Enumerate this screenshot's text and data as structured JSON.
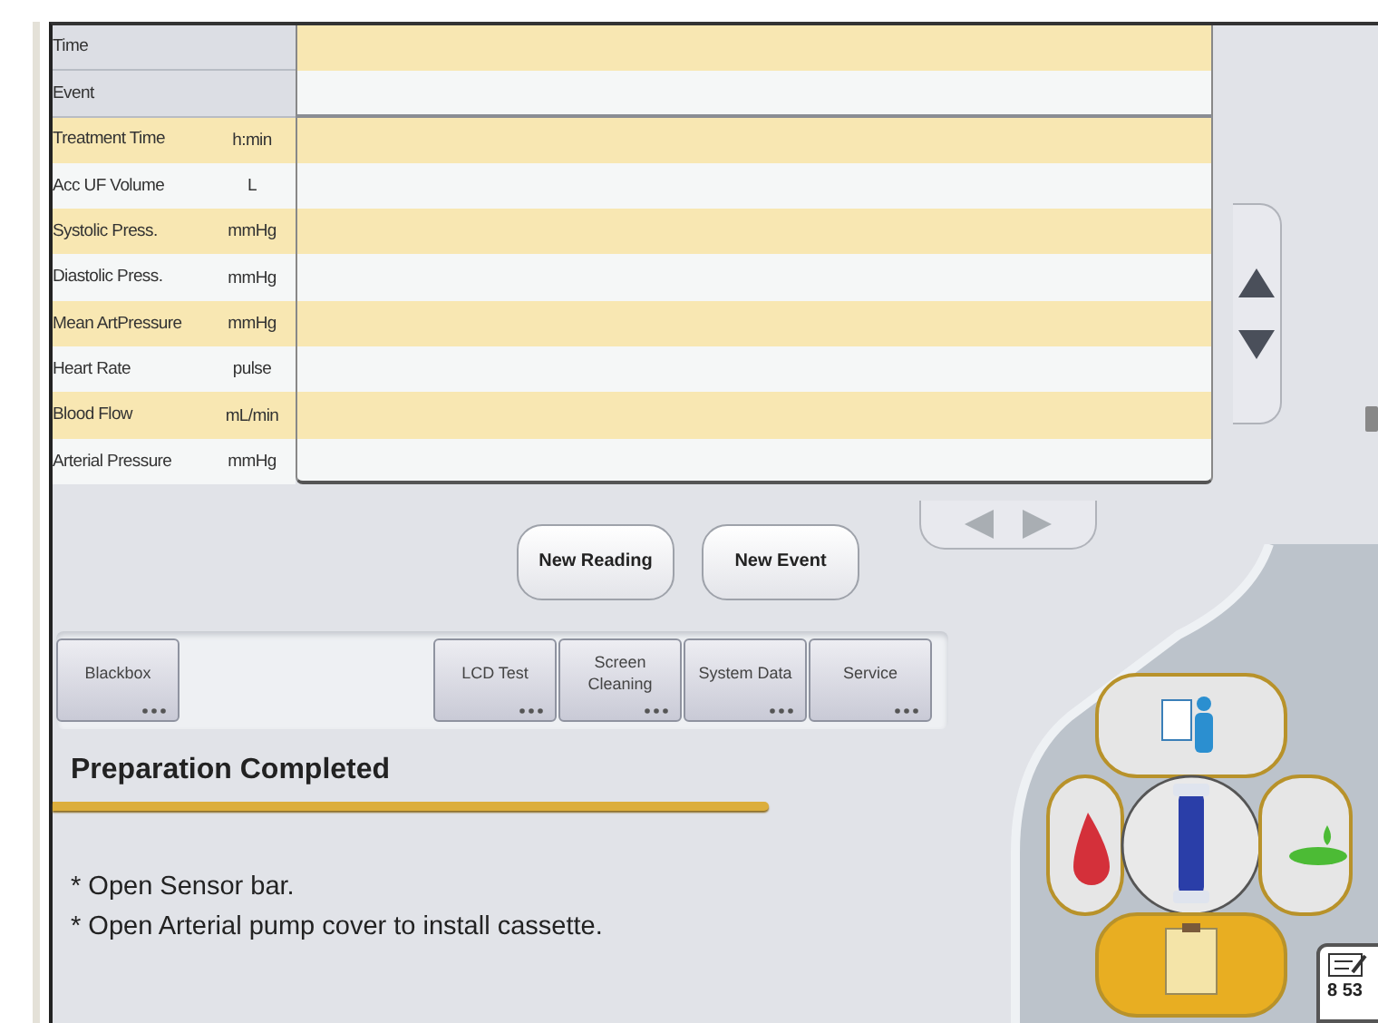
{
  "table": {
    "rows": [
      {
        "label": "Time",
        "kind": "header"
      },
      {
        "label": "Event",
        "kind": "header"
      },
      {
        "label": "Treatment Time",
        "unit": "h:min",
        "kind": "reading"
      },
      {
        "label": "Acc UF Volume",
        "unit": "L",
        "kind": "reading"
      },
      {
        "label": "Systolic Press.",
        "unit": "mmHg",
        "kind": "reading"
      },
      {
        "label": "Diastolic Press.",
        "unit": "mmHg",
        "kind": "reading"
      },
      {
        "label": "Mean ArtPressure",
        "unit": "mmHg",
        "kind": "reading"
      },
      {
        "label": "Heart Rate",
        "unit": "pulse",
        "kind": "reading"
      },
      {
        "label": "Blood Flow",
        "unit": "mL/min",
        "kind": "reading"
      },
      {
        "label": "Arterial Pressure",
        "unit": "mmHg",
        "kind": "reading"
      }
    ]
  },
  "actions": [
    "New Reading",
    "New Event"
  ],
  "toolbar": [
    {
      "label": "Blackbox",
      "kind": "left"
    },
    {
      "label": "LCD Test",
      "kind": "right"
    },
    {
      "label": "Screen Cleaning",
      "kind": "right"
    },
    {
      "label": "System Data",
      "kind": "right"
    },
    {
      "label": "Service",
      "kind": "right"
    }
  ],
  "status": {
    "title": "Preparation Completed",
    "instructions": [
      "* Open Sensor bar.",
      "* Open Arterial pump cover to install cassette."
    ]
  },
  "nav": [
    {
      "kind": "patient",
      "selected": false
    },
    {
      "kind": "blood",
      "selected": false
    },
    {
      "kind": "center",
      "selected": false
    },
    {
      "kind": "fluid",
      "selected": false
    },
    {
      "kind": "notes",
      "selected": true
    }
  ],
  "clock_button": {
    "text": "8 53"
  }
}
